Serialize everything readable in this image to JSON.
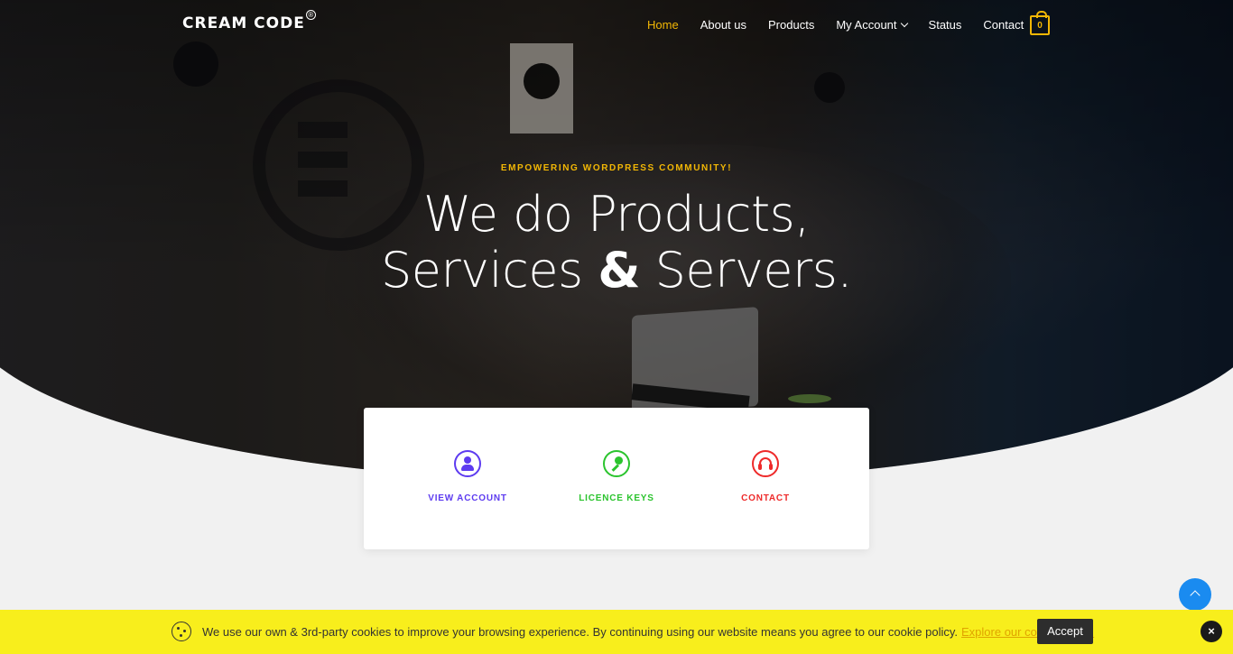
{
  "brand": {
    "logo_text": "CREAM CODE",
    "registered": "®"
  },
  "nav": {
    "items": [
      {
        "label": "Home",
        "active": true
      },
      {
        "label": "About us"
      },
      {
        "label": "Products"
      },
      {
        "label": "My Account",
        "has_dropdown": true
      },
      {
        "label": "Status"
      },
      {
        "label": "Contact"
      }
    ],
    "cart_count": "0"
  },
  "hero": {
    "kicker": "EMPOWERING WORDPRESS COMMUNITY!",
    "line1": "We do Products,",
    "line2_a": "Services",
    "line2_amp": "&",
    "line2_b": "Servers."
  },
  "quick_links": [
    {
      "label": "VIEW ACCOUNT",
      "icon": "user-icon",
      "color": "#5d3bf0"
    },
    {
      "label": "LICENCE KEYS",
      "icon": "key-icon",
      "color": "#2bc42e"
    },
    {
      "label": "CONTACT",
      "icon": "headphones-icon",
      "color": "#ee2a2a"
    }
  ],
  "cookie_banner": {
    "message": "We use our own & 3rd-party cookies to improve your browsing experience. By continuing using our website means you agree to our cookie policy.",
    "link_text": "Explore our cookie policy.",
    "accept_label": "Accept",
    "close_label": "×"
  },
  "colors": {
    "accent": "#f2b705",
    "banner": "#f8ee1c",
    "scroll_top": "#1a8bf0"
  }
}
